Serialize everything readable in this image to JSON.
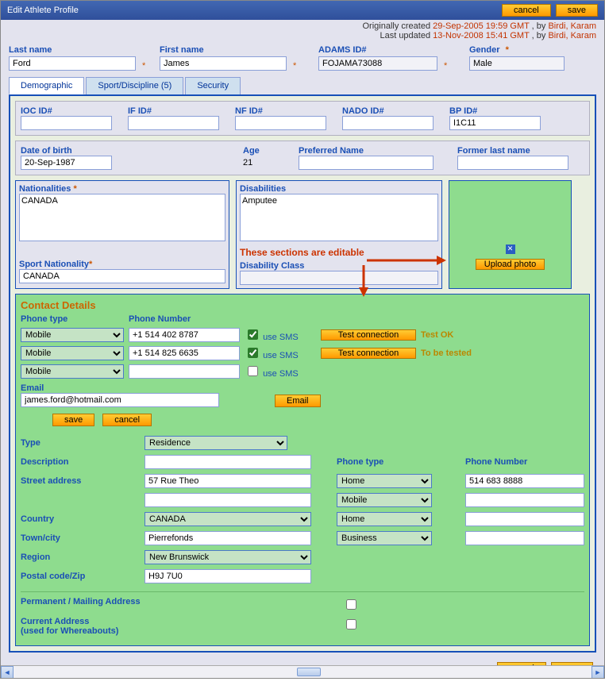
{
  "title": "Edit Athlete Profile",
  "buttons": {
    "cancel": "cancel",
    "save": "save",
    "upload": "Upload photo",
    "email": "Email",
    "test": "Test connection"
  },
  "meta": {
    "created_lbl": "Originally created ",
    "created_ts": "29-Sep-2005 19:59 GMT",
    "updated_lbl": "Last updated ",
    "updated_ts": "13-Nov-2008 15:41 GMT",
    "by": " , by ",
    "user": "Birdi, Karam"
  },
  "header": {
    "lastname_lbl": "Last name",
    "lastname": "Ford",
    "firstname_lbl": "First name",
    "firstname": "James",
    "adams_lbl": "ADAMS ID#",
    "adams": "FOJAMA73088",
    "gender_lbl": "Gender",
    "gender": "Male"
  },
  "tabs": {
    "t1": "Demographic",
    "t2": "Sport/Discipline (5)",
    "t3": "Security"
  },
  "ids": {
    "ioc": "IOC ID#",
    "if": "IF ID#",
    "nf": "NF ID#",
    "nado": "NADO ID#",
    "bp": "BP ID#",
    "bp_val": "I1C11",
    "dob_lbl": "Date of birth",
    "dob": "20-Sep-1987",
    "age_lbl": "Age",
    "age": "21",
    "pref_lbl": "Preferred Name",
    "former_lbl": "Former last name"
  },
  "nat": {
    "lbl": "Nationalities",
    "val": "CANADA",
    "sport_lbl": "Sport Nationality",
    "sport_val": "CANADA"
  },
  "dis": {
    "lbl": "Disabilities",
    "val": "Amputee",
    "class_lbl": "Disability Class"
  },
  "annot": "These sections are editable",
  "contact": {
    "title": "Contact Details",
    "ptype": "Phone type",
    "pnum": "Phone Number",
    "sms": "use SMS",
    "rows": [
      {
        "type": "Mobile",
        "num": "+1 514 402 8787",
        "sms": true,
        "status": "Test OK"
      },
      {
        "type": "Mobile",
        "num": "+1 514 825 6635",
        "sms": true,
        "status": "To be tested"
      },
      {
        "type": "Mobile",
        "num": "",
        "sms": false,
        "status": ""
      }
    ],
    "email_lbl": "Email",
    "email": "james.ford@hotmail.com"
  },
  "addr": {
    "type_lbl": "Type",
    "type": "Residence",
    "desc_lbl": "Description",
    "street_lbl": "Street address",
    "street": "57 Rue Theo",
    "country_lbl": "Country",
    "country": "CANADA",
    "town_lbl": "Town/city",
    "town": "Pierrefonds",
    "region_lbl": "Region",
    "region": "New Brunswick",
    "postal_lbl": "Postal code/Zip",
    "postal": "H9J 7U0",
    "ptype_lbl": "Phone type",
    "pnum_lbl": "Phone Number",
    "phones": [
      {
        "type": "Home",
        "num": "514 683 8888"
      },
      {
        "type": "Mobile",
        "num": ""
      },
      {
        "type": "Home",
        "num": ""
      },
      {
        "type": "Business",
        "num": ""
      }
    ],
    "perm_lbl": "Permanent / Mailing Address",
    "curr_lbl1": "Current Address",
    "curr_lbl2": "(used for Whereabouts)"
  }
}
